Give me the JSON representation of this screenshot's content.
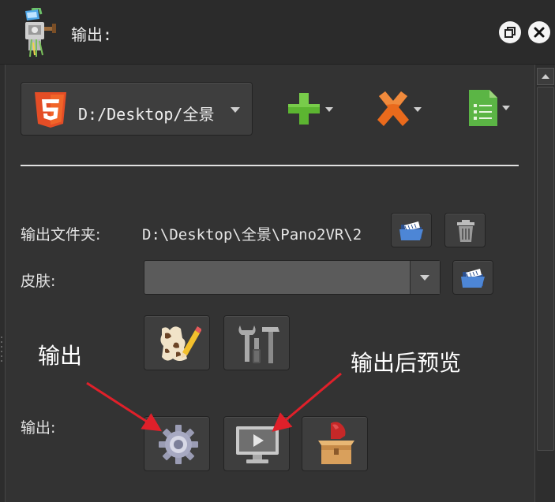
{
  "window": {
    "title": "输出:"
  },
  "output_format": {
    "selected": "D:/Desktop/全景",
    "format_icon": "html5-icon"
  },
  "toolbar": {
    "add_icon": "plus-icon",
    "remove_icon": "x-icon",
    "doc_icon": "document-icon"
  },
  "output_folder": {
    "label": "输出文件夹:",
    "path": "D:\\Desktop\\全景\\Pano2VR\\2"
  },
  "skin": {
    "label": "皮肤:",
    "value": ""
  },
  "output_row": {
    "label": "输出:"
  },
  "annotations": {
    "output": "输出",
    "preview": "输出后预览"
  },
  "colors": {
    "annotation_arrow": "#e0202a",
    "html5_orange": "#e44d26",
    "plus_green": "#5cb531",
    "x_orange": "#ea6a1c",
    "doc_green": "#5bb545"
  }
}
